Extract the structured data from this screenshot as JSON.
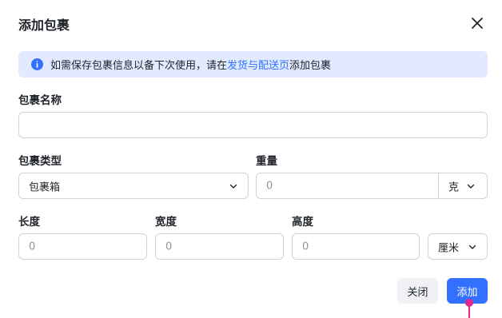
{
  "dialog": {
    "title": "添加包裹"
  },
  "notice": {
    "text_before": "如需保存包裹信息以备下次使用，请在",
    "link": "发货与配送页",
    "text_after": "添加包裹"
  },
  "form": {
    "package_name": {
      "label": "包裹名称",
      "value": ""
    },
    "package_type": {
      "label": "包裹类型",
      "selected": "包裹箱"
    },
    "weight": {
      "label": "重量",
      "placeholder": "0",
      "unit": "克"
    },
    "length": {
      "label": "长度",
      "placeholder": "0"
    },
    "width": {
      "label": "宽度",
      "placeholder": "0"
    },
    "height": {
      "label": "高度",
      "placeholder": "0"
    },
    "dimension_unit": "厘米"
  },
  "footer": {
    "close_label": "关闭",
    "add_label": "添加"
  },
  "colors": {
    "accent": "#3370ff",
    "notice_bg": "#e1eaff",
    "cursor": "#e0288a"
  },
  "icons": {
    "close": "close-icon",
    "info": "info-icon",
    "chevron": "chevron-down-icon"
  }
}
